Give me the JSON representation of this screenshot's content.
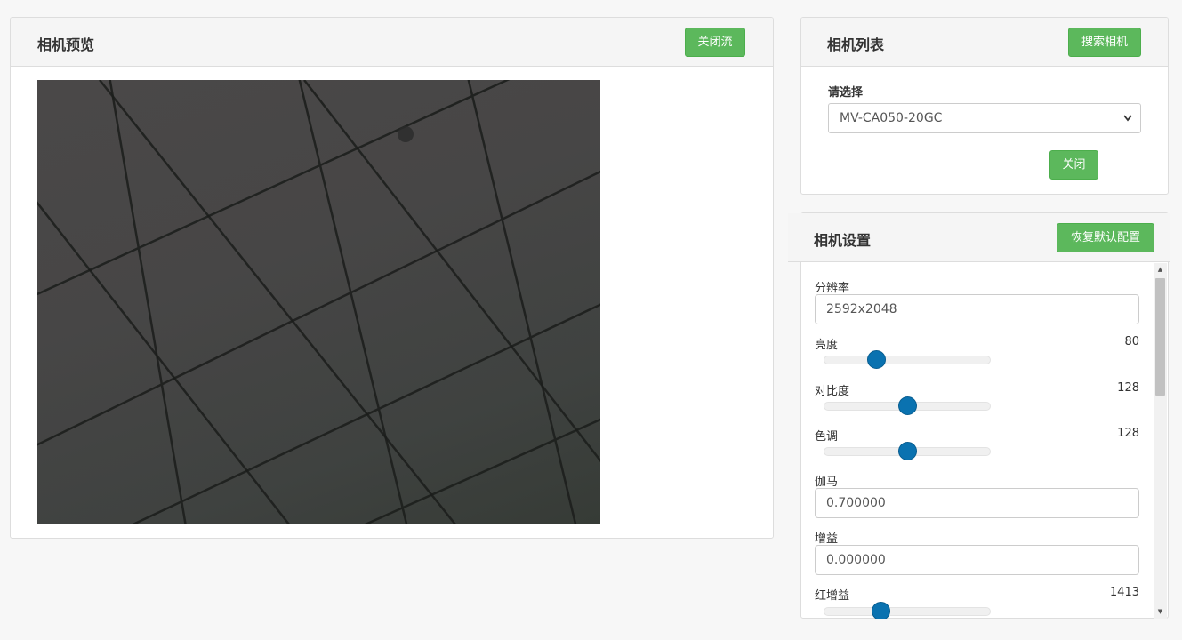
{
  "preview": {
    "title": "相机预览",
    "close_stream_label": "关闭流"
  },
  "camera_list": {
    "title": "相机列表",
    "search_label": "搜索相机",
    "select_label": "请选择",
    "selected_camera": "MV-CA050-20GC",
    "close_label": "关闭"
  },
  "settings": {
    "title": "相机设置",
    "restore_label": "恢复默认配置",
    "resolution": {
      "label": "分辨率",
      "value": "2592x2048"
    },
    "brightness": {
      "label": "亮度",
      "value": "80",
      "fraction": 0.31
    },
    "contrast": {
      "label": "对比度",
      "value": "128",
      "fraction": 0.5
    },
    "hue": {
      "label": "色调",
      "value": "128",
      "fraction": 0.5
    },
    "gamma": {
      "label": "伽马",
      "value": "0.700000"
    },
    "gain": {
      "label": "增益",
      "value": "0.000000"
    },
    "red_gain": {
      "label": "红增益",
      "value": "1413",
      "fraction": 0.34
    }
  },
  "colors": {
    "button_green": "#5cb85c",
    "slider_blue": "#0a72b0"
  }
}
